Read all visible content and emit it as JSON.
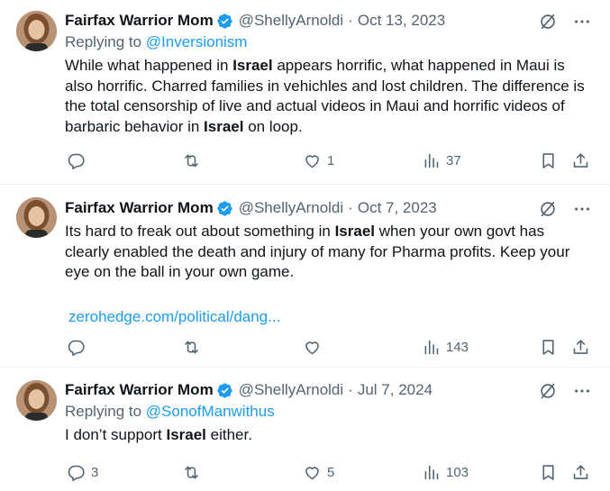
{
  "colors": {
    "accent": "#1d9bf0",
    "secondary_text": "#536471",
    "primary_text": "#0f1419",
    "divider": "#eff3f4"
  },
  "tweets": [
    {
      "display_name": "Fairfax Warrior Mom",
      "handle": "@ShellyArnoldi",
      "separator": "·",
      "date": "Oct 13, 2023",
      "replying_prefix": "Replying to ",
      "replying_handle": "@Inversionism",
      "text_parts": [
        "While what happened in ",
        "Israel",
        " appears horrific, what happened in Maui is also horrific. Charred families in vehichles and lost children. The difference is the total censorship of live and actual videos in Maui and horrific videos of barbaric behavior in ",
        "Israel",
        " on loop."
      ],
      "reply_count": "",
      "retweet_count": "",
      "like_count": "1",
      "view_count": "37"
    },
    {
      "display_name": "Fairfax Warrior Mom",
      "handle": "@ShellyArnoldi",
      "separator": "·",
      "date": "Oct 7, 2023",
      "text_parts": [
        "Its hard to freak out about something in ",
        "Israel",
        " when your own govt has clearly enabled the death and injury of many for Pharma profits.  Keep your eye on the ball in your own game."
      ],
      "link_text": "zerohedge.com/political/dang...",
      "reply_count": "",
      "retweet_count": "",
      "like_count": "",
      "view_count": "143"
    },
    {
      "display_name": "Fairfax Warrior Mom",
      "handle": "@ShellyArnoldi",
      "separator": "·",
      "date": "Jul 7, 2024",
      "replying_prefix": "Replying to ",
      "replying_handle": "@SonofManwithus",
      "text_parts": [
        "I don’t support ",
        "Israel",
        " either."
      ],
      "reply_count": "3",
      "retweet_count": "",
      "like_count": "5",
      "view_count": "103"
    }
  ],
  "icons": {
    "verified": "verified-badge-icon",
    "grok": "grok-icon",
    "more": "more-icon",
    "reply": "reply-icon",
    "retweet": "retweet-icon",
    "like": "heart-icon",
    "views": "views-chart-icon",
    "bookmark": "bookmark-icon",
    "share": "share-icon"
  }
}
